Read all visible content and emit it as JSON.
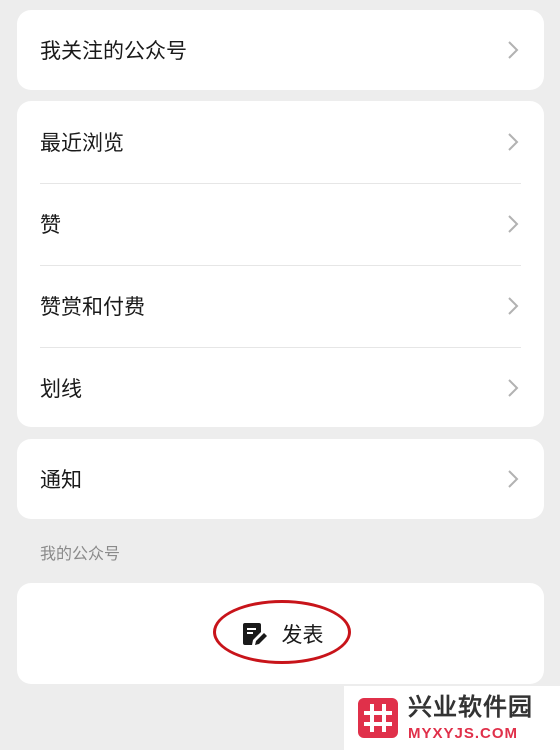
{
  "groups": [
    {
      "items": [
        {
          "label": "我关注的公众号"
        }
      ]
    },
    {
      "items": [
        {
          "label": "最近浏览"
        },
        {
          "label": "赞"
        },
        {
          "label": "赞赏和付费"
        },
        {
          "label": "划线"
        }
      ]
    },
    {
      "items": [
        {
          "label": "通知"
        }
      ]
    }
  ],
  "my_accounts_section": {
    "label": "我的公众号"
  },
  "publish": {
    "label": "发表",
    "icon": "document-edit-icon"
  },
  "annotation": {
    "color": "#c8141a"
  },
  "watermark": {
    "title": "兴业软件园",
    "url": "MYXYJS.COM",
    "accent": "#e0304a"
  }
}
